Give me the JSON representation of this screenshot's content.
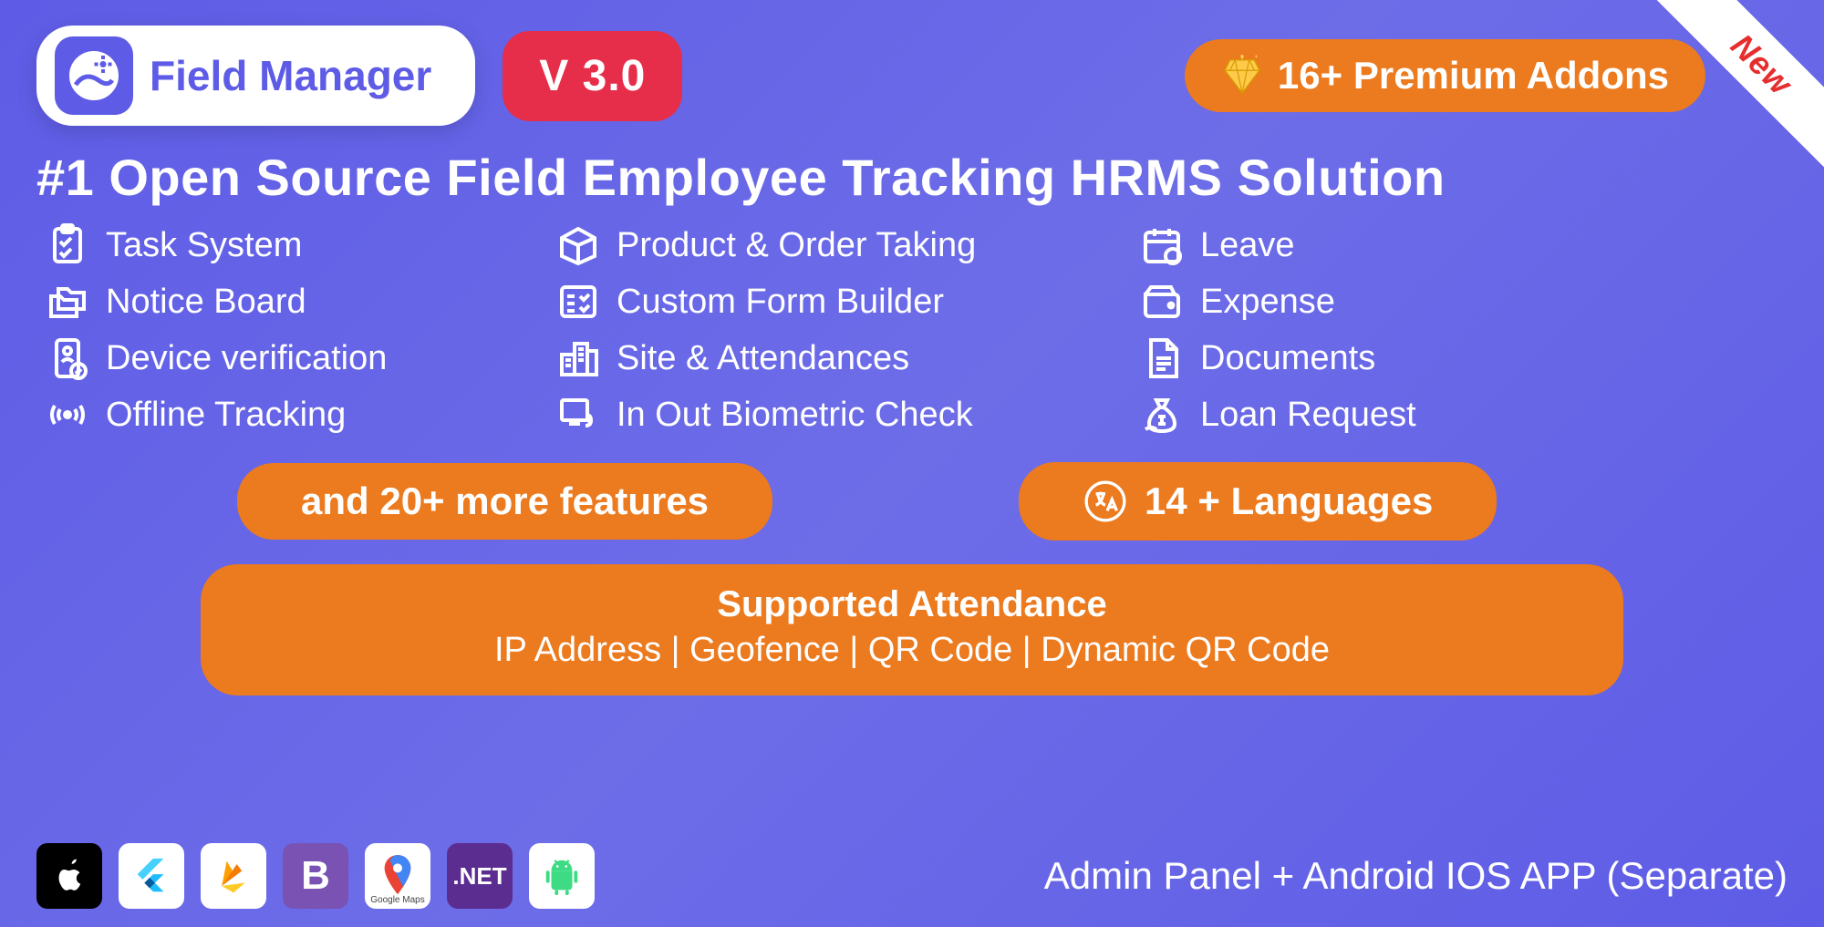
{
  "corner_ribbon": "New",
  "logo_text": "Field Manager",
  "version_label": "V 3.0",
  "addons_label": "16+ Premium Addons",
  "headline": "#1 Open Source Field Employee Tracking HRMS Solution",
  "features": {
    "col1": [
      "Task System",
      "Notice Board",
      "Device verification",
      "Offline Tracking"
    ],
    "col2": [
      "Product & Order Taking",
      "Custom Form Builder",
      "Site & Attendances",
      "In Out Biometric Check"
    ],
    "col3": [
      "Leave",
      "Expense",
      "Documents",
      "Loan Request"
    ]
  },
  "more_features_label": "and 20+ more features",
  "languages_label": "14 + Languages",
  "attendance": {
    "title": "Supported Attendance",
    "sub": "IP Address | Geofence |  QR Code | Dynamic QR Code"
  },
  "tech": {
    "bootstrap_letter": "B",
    "dotnet_label": ".NET",
    "maps_label": "Google Maps"
  },
  "footer_text": "Admin Panel + Android IOS APP (Separate)"
}
